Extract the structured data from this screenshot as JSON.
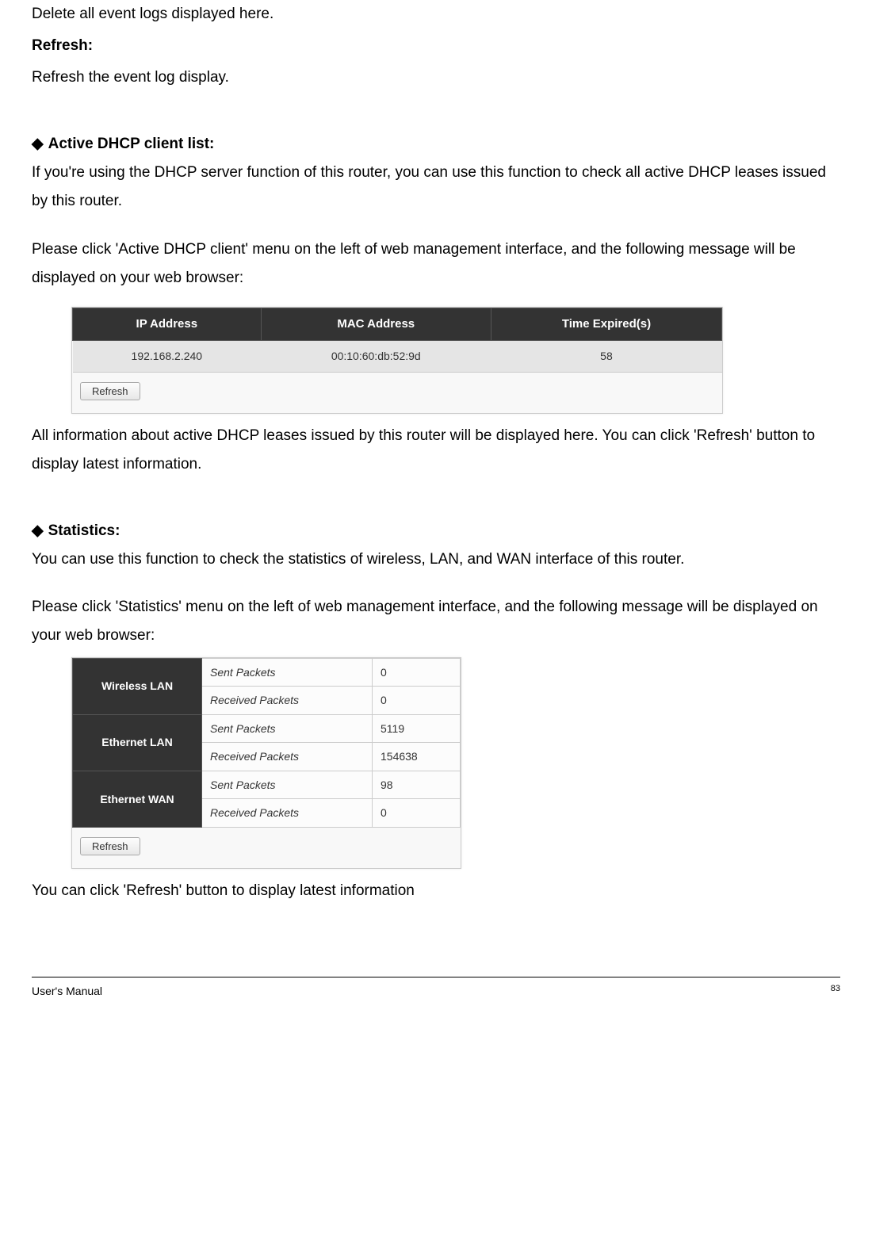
{
  "intro": {
    "delete_text": "Delete all event logs displayed here.",
    "refresh_label": "Refresh:",
    "refresh_text": "Refresh the event log display."
  },
  "dhcp": {
    "heading": "Active DHCP client list:",
    "para1": "If you're using the DHCP server function of this router, you can use this function to check all active DHCP leases issued by this router.",
    "para2": "Please click 'Active DHCP client' menu on the left of web management interface, and the following message will be displayed on your web browser:",
    "table": {
      "headers": {
        "ip": "IP Address",
        "mac": "MAC Address",
        "time": "Time Expired(s)"
      },
      "row": {
        "ip": "192.168.2.240",
        "mac": "00:10:60:db:52:9d",
        "time": "58"
      }
    },
    "refresh_btn": "Refresh",
    "para3": "All information about active DHCP leases issued by this router will be displayed here. You can click 'Refresh' button to display latest information."
  },
  "stats": {
    "heading": "Statistics:",
    "para1": "You can use this function to check the statistics of wireless, LAN, and WAN interface of this router.",
    "para2": "Please click 'Statistics' menu on the left of web management interface, and the following message will be displayed on your web browser:",
    "table": {
      "wlan_label": "Wireless LAN",
      "elan_label": "Ethernet LAN",
      "ewan_label": "Ethernet WAN",
      "sent_label": "Sent Packets",
      "recv_label": "Received Packets",
      "wlan_sent": "0",
      "wlan_recv": "0",
      "elan_sent": "5119",
      "elan_recv": "154638",
      "ewan_sent": "98",
      "ewan_recv": "0"
    },
    "refresh_btn": "Refresh",
    "para3": "You can click 'Refresh' button to display latest information"
  },
  "footer": {
    "left": "User's Manual",
    "right": "83"
  }
}
